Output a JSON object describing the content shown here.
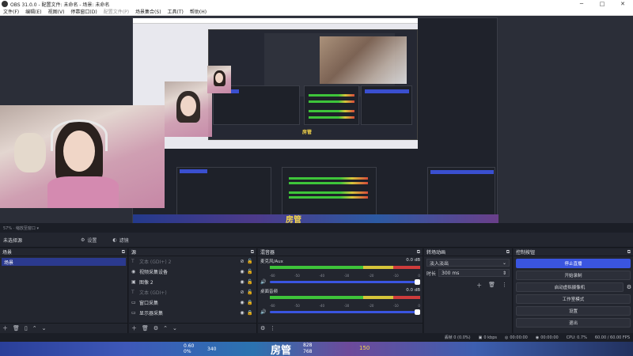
{
  "window": {
    "title": "OBS 31.0.0 - 配置文件: 未命名 - 场景: 未命名",
    "minimize": "─",
    "maximize": "□",
    "close": "✕"
  },
  "menu": [
    "文件(F)",
    "编辑(E)",
    "视图(V)",
    "停靠窗口(D)",
    "配置文件(P)",
    "场景集合(S)",
    "工具(T)",
    "帮助(H)"
  ],
  "menu_disabled": [
    4
  ],
  "preview": {
    "overlay_tag": "房管",
    "inner_tag": "房管",
    "inner_title": "OBS 31.0.0 · 配置文件: 未命名"
  },
  "scene_status": "57%  · 缩放至窗口  ▾",
  "toolbar": {
    "no_source": "未选择源",
    "properties": "设置",
    "filters": "滤镜",
    "properties_icon": "gear-icon",
    "filters_icon": "filter-icon"
  },
  "scenes": {
    "title": "场景",
    "items": [
      "场景"
    ]
  },
  "sources": {
    "title": "源",
    "items": [
      {
        "name": "文本 (GDI+) 2",
        "icon": "T",
        "dim": true,
        "hidden": true
      },
      {
        "name": "视频采集设备",
        "icon": "◉",
        "dim": false,
        "hidden": false
      },
      {
        "name": "图像 2",
        "icon": "▣",
        "dim": false,
        "hidden": false
      },
      {
        "name": "文本 (GDI+)",
        "icon": "T",
        "dim": true,
        "hidden": true
      },
      {
        "name": "窗口采集",
        "icon": "▭",
        "dim": false,
        "hidden": false
      },
      {
        "name": "显示器采集",
        "icon": "▭",
        "dim": false,
        "hidden": false
      }
    ]
  },
  "mixer": {
    "title": "混音器",
    "tracks": [
      {
        "name": "麦克风/Aux",
        "db": "0.0 dB"
      },
      {
        "name": "桌面音频",
        "db": "0.0 dB"
      }
    ],
    "scale": [
      "-60",
      "-55",
      "-50",
      "-45",
      "-40",
      "-35",
      "-30",
      "-25",
      "-20",
      "-15",
      "-10",
      "-5",
      "0"
    ]
  },
  "transitions": {
    "title": "转场动画",
    "selected": "淡入淡出",
    "duration_label": "时长",
    "duration": "300 ms"
  },
  "controls": {
    "title": "控制按钮",
    "stop_stream": "停止直播",
    "start_record": "开始录制",
    "virtual_cam": "启动虚拟摄像机",
    "studio_mode": "工作室模式",
    "settings": "设置",
    "exit": "退出"
  },
  "status": {
    "dropped": "丢帧 0 (0.0%)",
    "bitrate": "0 kbps",
    "stream_time": "00:00:00",
    "record_time": "00:00:00",
    "cpu": "CPU: 0.7%",
    "fps": "60.00 / 60.00 FPS"
  },
  "taskbar": {
    "a": "0.60",
    "b": "0%",
    "c": "340",
    "d": "房管",
    "e": "150",
    "f": "828",
    "g": "768"
  },
  "colors": {
    "accent": "#3a55e0",
    "meter_green": "#3ec43a",
    "meter_yellow": "#d6c53a",
    "meter_red": "#cf3c3c"
  }
}
